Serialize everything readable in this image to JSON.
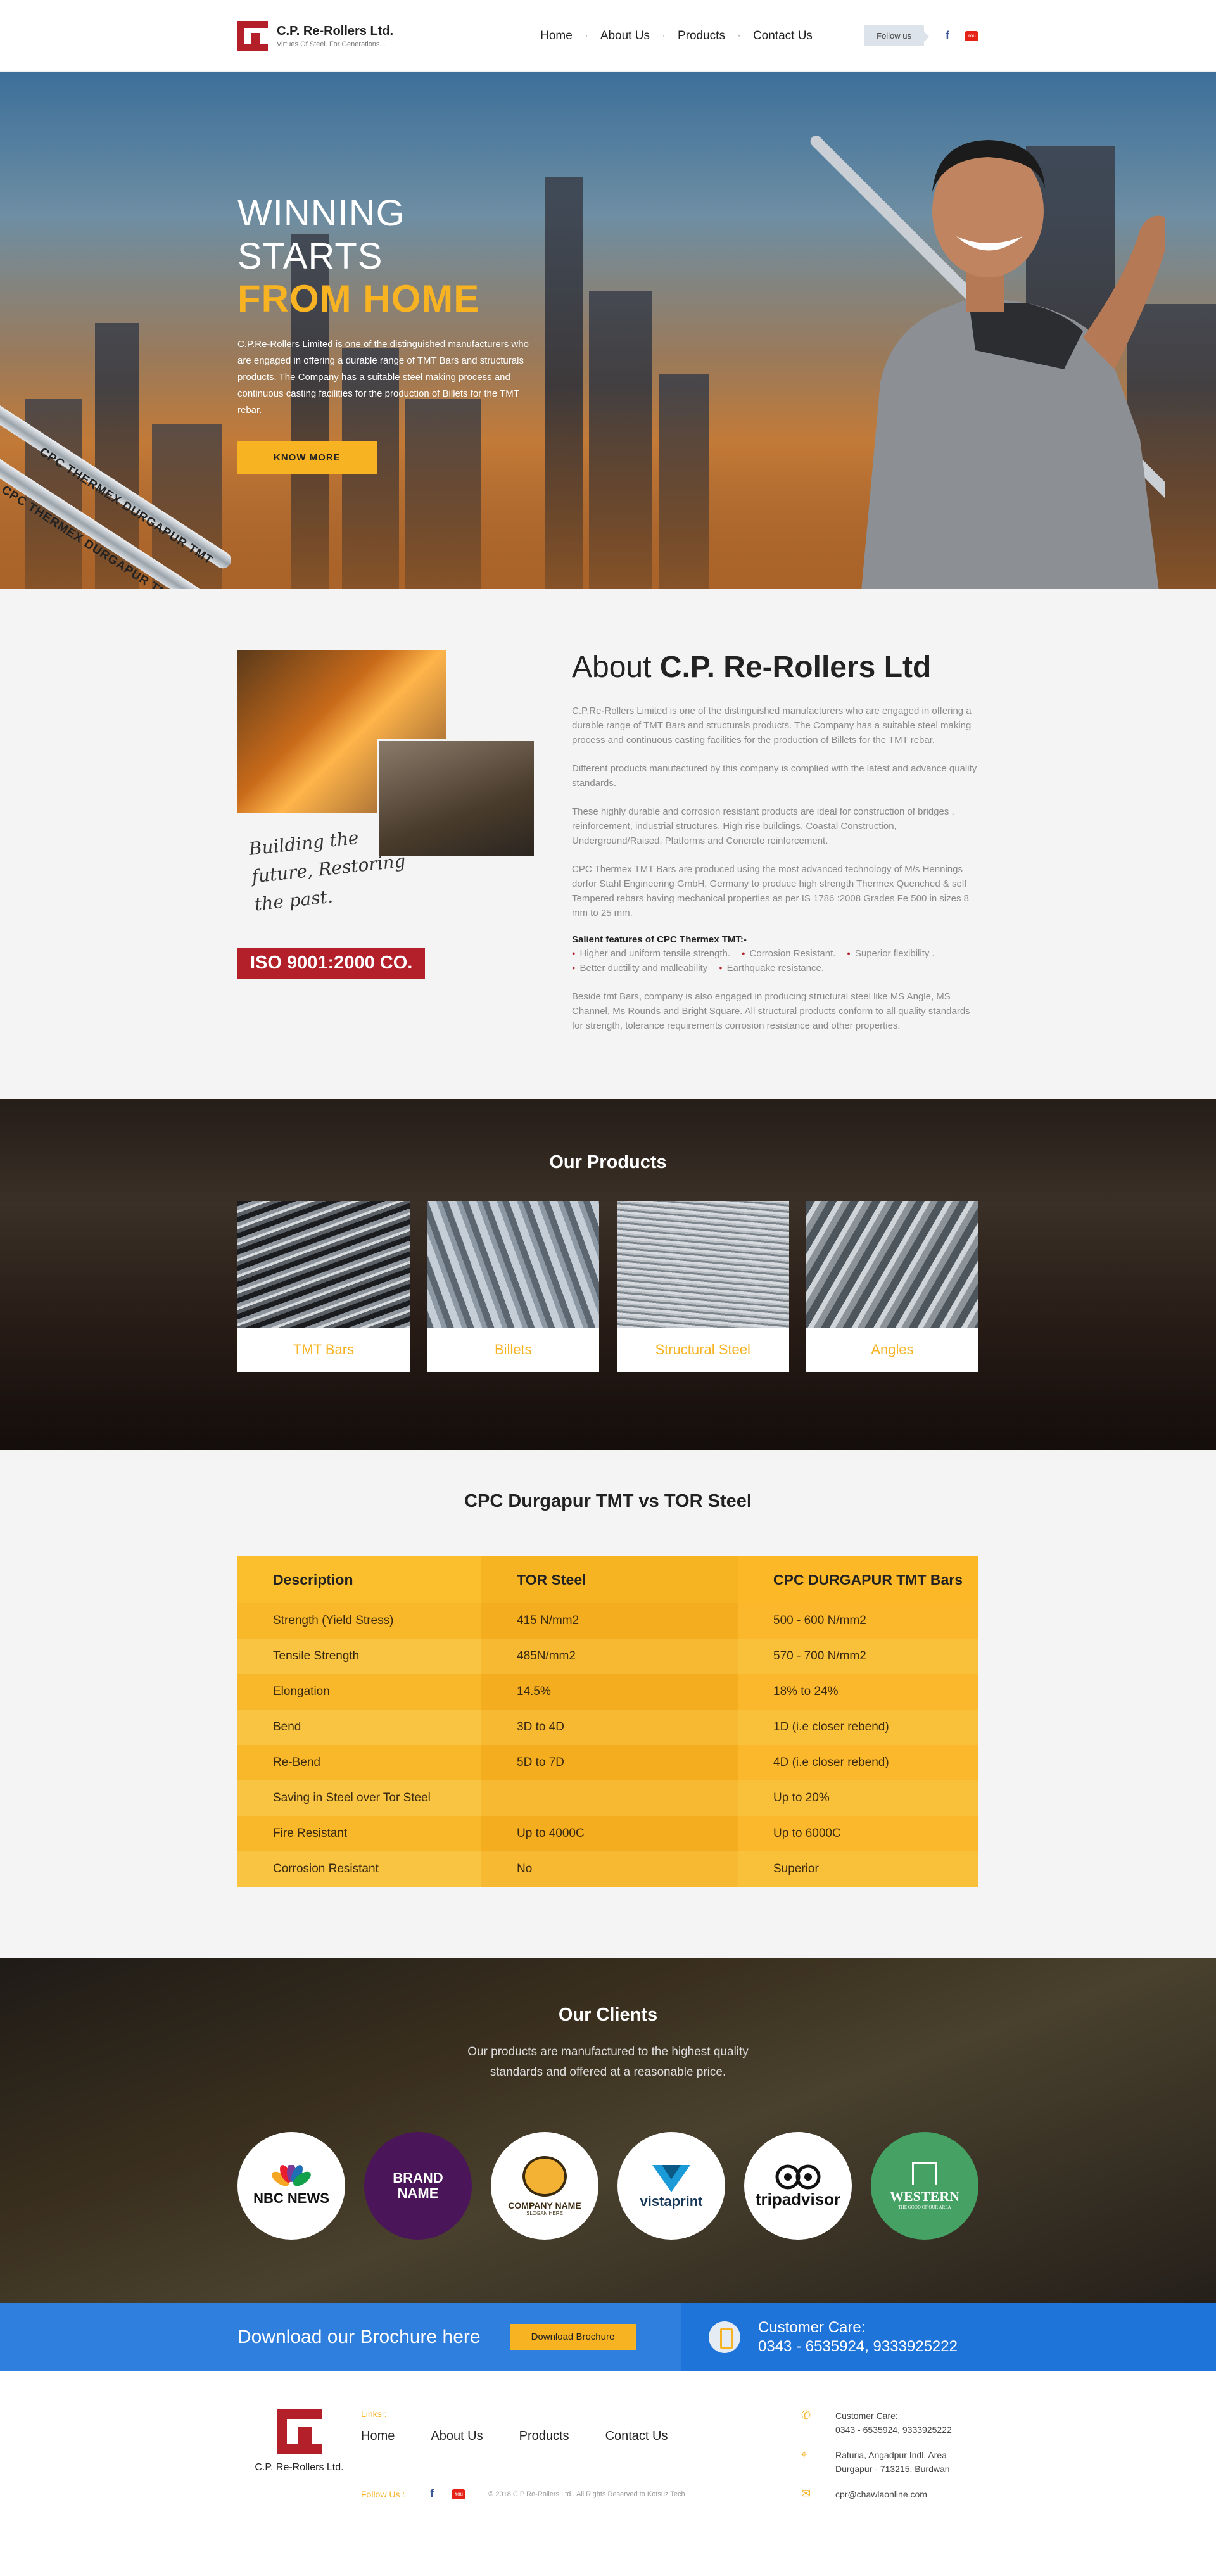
{
  "header": {
    "brand": "C.P. Re-Rollers Ltd.",
    "tagline": "Virtues Of Steel. For Generations...",
    "nav": [
      "Home",
      "About Us",
      "Products",
      "Contact Us"
    ],
    "follow_label": "Follow us",
    "facebook_icon": "f",
    "youtube_icon": "You Tube"
  },
  "hero": {
    "line1": "WINNING STARTS",
    "line2": "FROM HOME",
    "body": "C.P.Re-Rollers Limited is one of the distinguished manufacturers who are engaged in offering a durable range of TMT Bars and structurals products. The Company has a suitable steel making process and continuous casting facilities for the production of Billets for the TMT  rebar.",
    "button": "KNOW MORE",
    "rebar_text": "CPC THERMEX DURGAPUR TMT"
  },
  "about": {
    "title_plain": "About ",
    "title_bold": "C.P. Re-Rollers Ltd",
    "script_text": [
      "Building the",
      "future, Restoring",
      "the past."
    ],
    "iso": "ISO 9001:2000 CO.",
    "paragraphs": [
      "C.P.Re-Rollers Limited is one of the distinguished manufacturers who are engaged in offering a durable range of TMT Bars and structurals products. The Company has a suitable steel making process and continuous casting facilities for the production of Billets for the TMT  rebar.",
      "Different products manufactured  by this company is complied with the latest and advance quality standards.",
      "These highly durable and corrosion resistant products are ideal for construction of bridges , reinforcement, industrial structures, High rise buildings, Coastal Construction, Underground/Raised, Platforms and Concrete reinforcement.",
      "CPC Thermex  TMT Bars are produced using the most advanced technology of M/s Hennings dorfor Stahl Engineering GmbH, Germany to produce high strength Thermex Quenched & self Tempered rebars having mechanical properties as per IS 1786 :2008 Grades Fe 500 in sizes 8 mm to 25 mm."
    ],
    "salient_heading": "Salient features of CPC Thermex TMT:-",
    "salient": [
      "Higher and uniform tensile strength.",
      "Corrosion Resistant.",
      "Superior flexibility .",
      "Better ductility and malleability",
      "Earthquake resistance."
    ],
    "closing": "Beside tmt Bars, company is also engaged in producing structural steel like MS Angle, MS Channel, Ms Rounds and Bright Square. All structural products conform to all quality standards for strength, tolerance requirements corrosion resistance and other properties."
  },
  "products": {
    "title": "Our Products",
    "items": [
      "TMT Bars",
      "Billets",
      "Structural Steel",
      "Angles"
    ]
  },
  "compare": {
    "title": "CPC Durgapur TMT vs TOR Steel",
    "headers": [
      "Description",
      "TOR Steel",
      "CPC DURGAPUR TMT Bars"
    ],
    "rows": [
      [
        "Strength (Yield Stress)",
        "415 N/mm2",
        "500 - 600 N/mm2"
      ],
      [
        "Tensile Strength",
        "485N/mm2",
        "570 - 700 N/mm2"
      ],
      [
        "Elongation",
        "14.5%",
        "18% to 24%"
      ],
      [
        "Bend",
        "3D to 4D",
        "1D (i.e closer rebend)"
      ],
      [
        "Re-Bend",
        "5D to 7D",
        "4D (i.e closer rebend)"
      ],
      [
        "Saving in Steel over Tor Steel",
        "",
        "Up to 20%"
      ],
      [
        "Fire Resistant",
        "Up to 4000C",
        "Up to 6000C"
      ],
      [
        "Corrosion Resistant",
        "No",
        "Superior"
      ]
    ]
  },
  "clients": {
    "title": "Our Clients",
    "subtitle": "Our products are manufactured to the highest quality standards and offered at a reasonable price.",
    "logos": [
      "NBC NEWS",
      "BRAND NAME",
      "COMPANY NAME",
      "vistaprint",
      "tripadvisor",
      "WESTERN"
    ],
    "logo_sub": [
      "",
      "",
      "SLOGAN HERE",
      "",
      "",
      "THE GOOD OF OUR AREA"
    ]
  },
  "brochure": {
    "text": "Download our Brochure here",
    "button": "Download Brochure",
    "care_title": "Customer Care:",
    "care_numbers": "0343 - 6535924, 9333925222"
  },
  "footer": {
    "brand": "C.P. Re-Rollers Ltd.",
    "links_heading": "Links :",
    "links": [
      "Home",
      "About Us",
      "Products",
      "Contact Us"
    ],
    "follow": "Follow Us :",
    "copyright": "© 2018 C.P Re-Rollers Ltd.. All Rights Reserved to Kotsuz Tech",
    "care_label": "Customer Care:",
    "care_numbers": "0343 - 6535924, 9333925222",
    "address_1": "Raturia, Angadpur Indl. Area",
    "address_2": "Durgapur - 713215, Burdwan",
    "email": "cpr@chawlaonline.com"
  },
  "colors": {
    "accent": "#f7b322",
    "brand_red": "#b3202a",
    "bar_blue": "#2f7fde"
  }
}
